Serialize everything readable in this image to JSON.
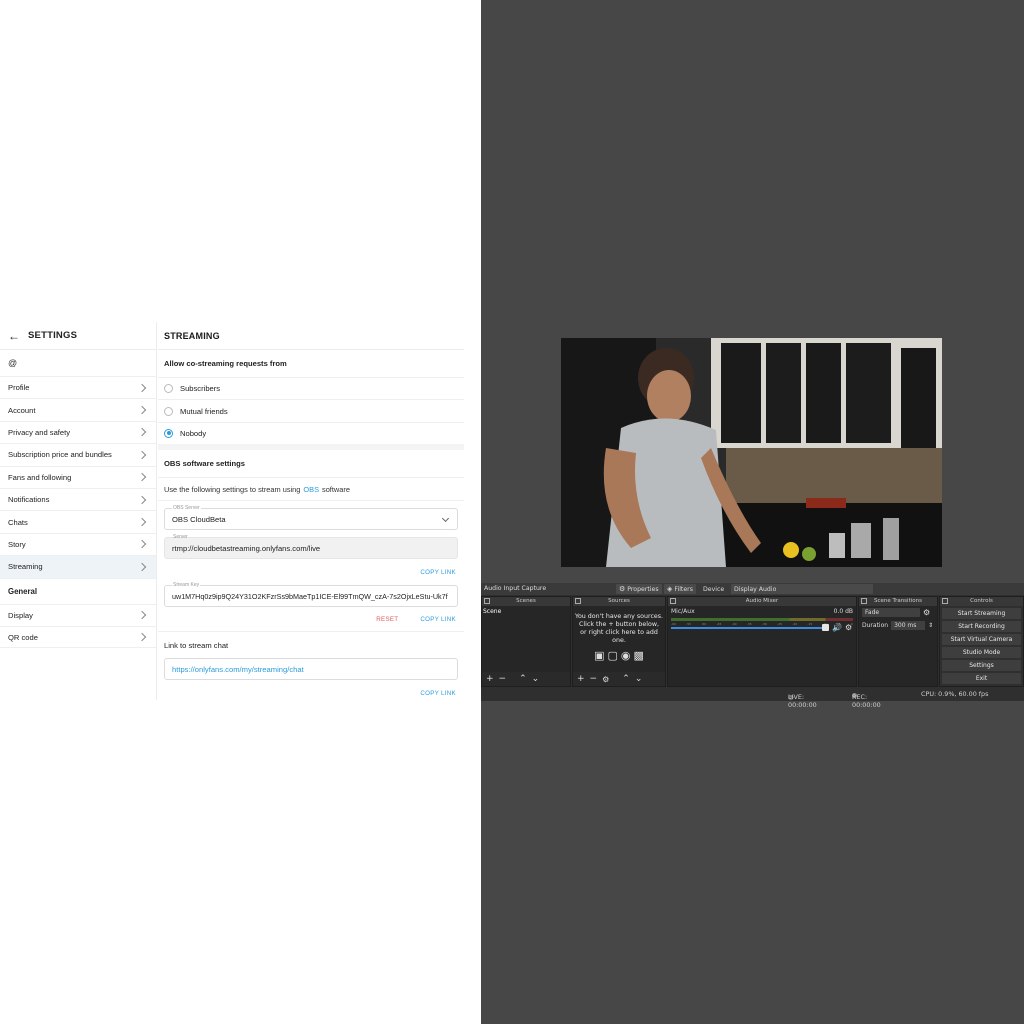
{
  "settings": {
    "sidebar": {
      "back_icon": "arrow-left-icon",
      "title": "SETTINGS",
      "at": "@",
      "items": [
        {
          "label": "Profile"
        },
        {
          "label": "Account"
        },
        {
          "label": "Privacy and safety"
        },
        {
          "label": "Subscription price and bundles"
        },
        {
          "label": "Fans and following"
        },
        {
          "label": "Notifications"
        },
        {
          "label": "Chats"
        },
        {
          "label": "Story"
        },
        {
          "label": "Streaming",
          "active": true
        }
      ],
      "section_general": "General",
      "general_items": [
        {
          "label": "Display"
        },
        {
          "label": "QR code"
        }
      ]
    },
    "streaming": {
      "title": "STREAMING",
      "costream_heading": "Allow co-streaming requests from",
      "options": [
        "Subscribers",
        "Mutual friends",
        "Nobody"
      ],
      "selected_option": "Nobody",
      "obs_heading": "OBS software settings",
      "obs_desc_before": "Use the following settings to stream using",
      "obs_link": "OBS",
      "obs_desc_after": "software",
      "server_select_label": "OBS Server",
      "server_select_value": "OBS CloudBeta",
      "server_label": "Server",
      "server_value": "rtmp://cloudbetastreaming.onlyfans.com/live",
      "copy_link": "COPY LINK",
      "stream_key_label": "Stream Key",
      "stream_key_value": "uw1M7Hq0z9ip9Q24Y31O2KFzrSs9bMaeTp1ICE-El99TmQW_czA-7s2OjxLeStu-Uk7f",
      "reset": "RESET",
      "chat_heading": "Link to stream chat",
      "chat_url": "https://onlyfans.com/my/streaming/chat",
      "accent_color": "#2c9cdb"
    }
  },
  "obs": {
    "toolbar": {
      "source_name": "Audio Input Capture",
      "properties": "Properties",
      "filters": "Filters",
      "device": "Device",
      "device_value": "Display Audio"
    },
    "scenes": {
      "title": "Scenes",
      "items": [
        "Scene"
      ]
    },
    "sources": {
      "title": "Sources",
      "empty_line1": "You don't have any sources.",
      "empty_line2": "Click the + button below,",
      "empty_line3": "or right click here to add one."
    },
    "mixer": {
      "title": "Audio Mixer",
      "channel": "Mic/Aux",
      "level": "0.0 dB",
      "scale": [
        "-60",
        "-55",
        "-50",
        "-45",
        "-40",
        "-35",
        "-30",
        "-25",
        "-20",
        "-15",
        "-10",
        "-5",
        "0"
      ]
    },
    "transitions": {
      "title": "Scene Transitions",
      "type": "Fade",
      "duration_label": "Duration",
      "duration_value": "300 ms"
    },
    "controls": {
      "title": "Controls",
      "buttons": [
        "Start Streaming",
        "Start Recording",
        "Start Virtual Camera",
        "Studio Mode",
        "Settings",
        "Exit"
      ]
    },
    "status": {
      "live": "LIVE: 00:00:00",
      "rec": "REC: 00:00:00",
      "cpu": "CPU: 0.9%, 60.00 fps"
    }
  }
}
